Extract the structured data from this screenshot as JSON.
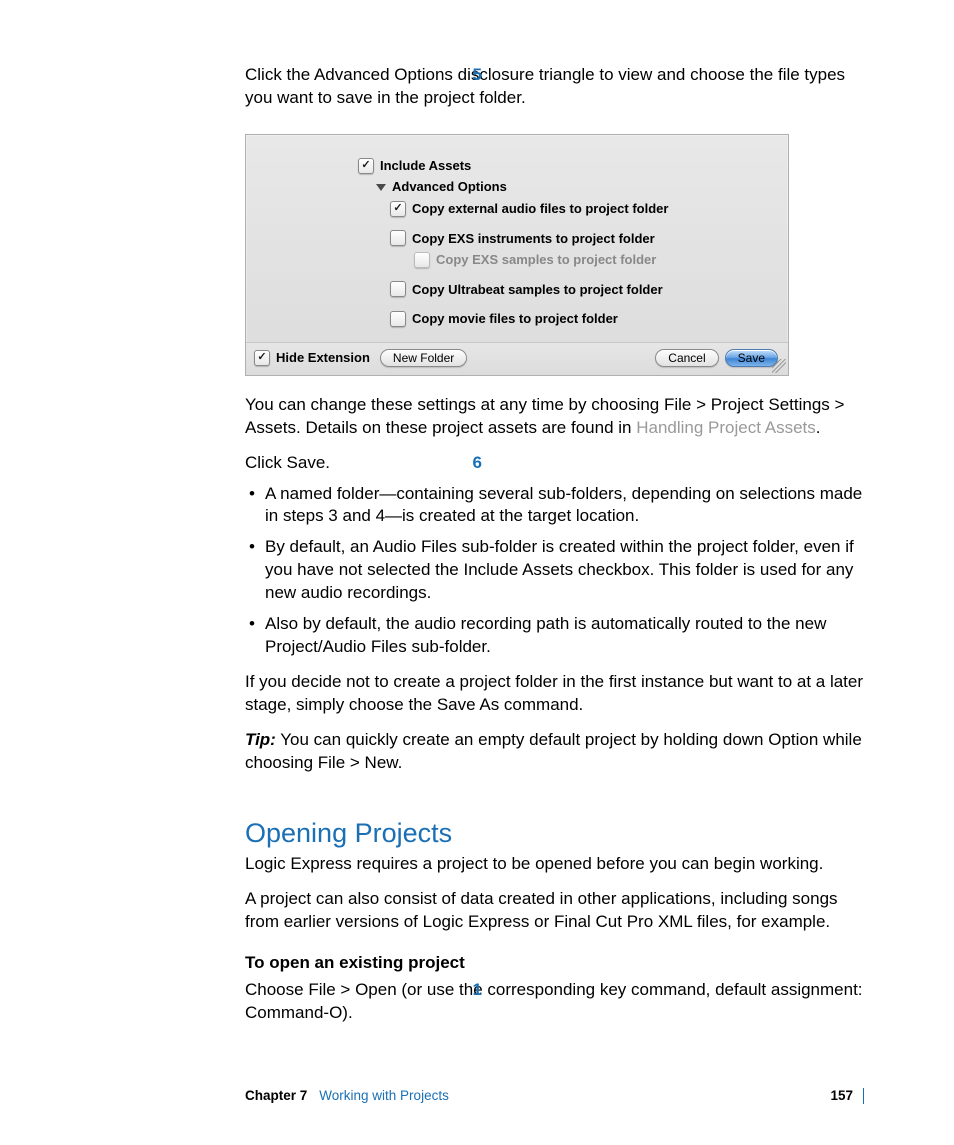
{
  "step5": {
    "num": "5",
    "text": "Click the Advanced Options disclosure triangle to view and choose the file types you want to save in the project folder."
  },
  "dialog": {
    "include_assets": "Include Assets",
    "advanced_options": "Advanced Options",
    "opt_copy_audio": "Copy external audio files to project folder",
    "opt_copy_exs_instruments": "Copy EXS instruments to project folder",
    "opt_copy_exs_samples": "Copy EXS samples to project folder",
    "opt_copy_ultrabeat": "Copy Ultrabeat samples to project folder",
    "opt_copy_movie": "Copy movie files to project folder",
    "hide_extension": "Hide Extension",
    "new_folder_btn": "New Folder",
    "cancel_btn": "Cancel",
    "save_btn": "Save"
  },
  "after_dialog": {
    "p1_a": "You can change these settings at any time by choosing File > Project Settings > Assets. Details on these project assets are found in ",
    "p1_link": "Handling Project Assets",
    "p1_b": "."
  },
  "step6": {
    "num": "6",
    "text": "Click Save.",
    "b1": "A named folder—containing several sub-folders, depending on selections made in steps 3 and 4—is created at the target location.",
    "b2": "By default, an Audio Files sub-folder is created within the project folder, even if you have not selected the Include Assets checkbox. This folder is used for any new audio recordings.",
    "b3": "Also by default, the audio recording path is automatically routed to the new Project/Audio Files sub-folder."
  },
  "para_decide": "If you decide not to create a project folder in the first instance but want to at a later stage, simply choose the Save As command.",
  "tip": {
    "label": "Tip:",
    "text": "  You can quickly create an empty default project by holding down Option while choosing File > New."
  },
  "section": {
    "heading": "Opening Projects",
    "p1": "Logic Express requires a project to be opened before you can begin working.",
    "p2": "A project can also consist of data created in other applications, including songs from earlier versions of Logic Express or Final Cut Pro XML files, for example.",
    "subhead": "To open an existing project"
  },
  "step1": {
    "num": "1",
    "text": "Choose File > Open (or use the corresponding key command, default assignment:  Command-O)."
  },
  "footer": {
    "chapter": "Chapter 7",
    "title": "Working with Projects",
    "page": "157"
  }
}
